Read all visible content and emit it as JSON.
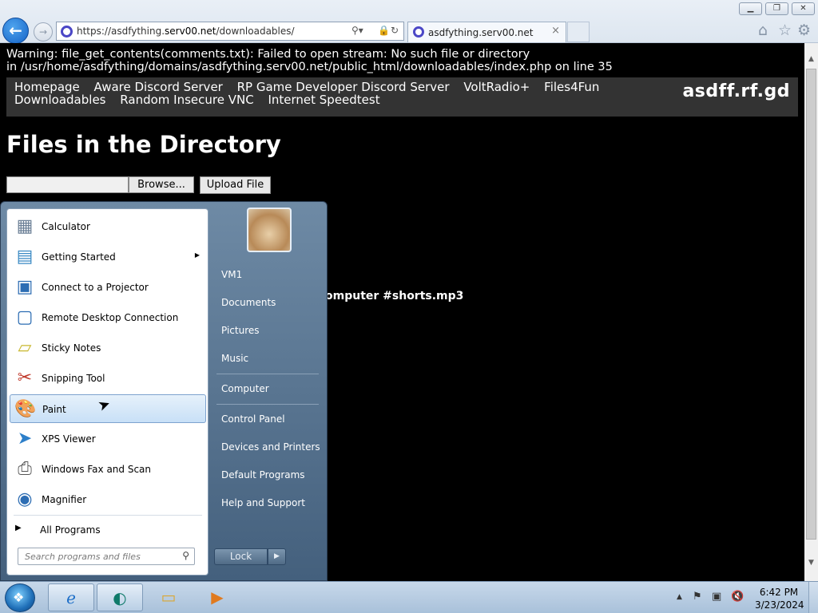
{
  "browser": {
    "url_prefix": "https://asdfything.",
    "url_domain": "serv00.net",
    "url_path": "/downloadables/",
    "tab_title": "asdfything.serv00.net",
    "tab_close": "×",
    "window_minimize": "▁",
    "window_restore": "❐",
    "window_close": "✕",
    "back_glyph": "←",
    "forward_glyph": "→"
  },
  "page": {
    "warning_line1": "Warning: file_get_contents(comments.txt): Failed to open stream: No such file or directory",
    "warning_line2": "in /usr/home/asdfything/domains/asdfything.serv00.net/public_html/downloadables/index.php on line 35",
    "nav_links": [
      "Homepage",
      "Aware Discord Server",
      "RP Game Developer Discord Server",
      "VoltRadio+",
      "Files4Fun",
      "Downloadables",
      "Random Insecure VNC",
      "Internet Speedtest"
    ],
    "brand": "asdff.rf.gd",
    "title": "Files in the Directory",
    "browse_label": "Browse...",
    "upload_label": "Upload File",
    "file_link_visible": "omputer #shorts.mp3"
  },
  "start_menu": {
    "programs": [
      {
        "label": "Calculator",
        "icon": "calculator-icon",
        "glyph": "▦"
      },
      {
        "label": "Getting Started",
        "icon": "getting-started-icon",
        "glyph": "▤"
      },
      {
        "label": "Connect to a Projector",
        "icon": "projector-icon",
        "glyph": "▣"
      },
      {
        "label": "Remote Desktop Connection",
        "icon": "remote-desktop-icon",
        "glyph": "▢"
      },
      {
        "label": "Sticky Notes",
        "icon": "sticky-notes-icon",
        "glyph": "▱"
      },
      {
        "label": "Snipping Tool",
        "icon": "scissors-icon",
        "glyph": "✂"
      },
      {
        "label": "Paint",
        "icon": "paint-palette-icon",
        "glyph": "🎨"
      },
      {
        "label": "XPS Viewer",
        "icon": "paper-plane-icon",
        "glyph": "➤"
      },
      {
        "label": "Windows Fax and Scan",
        "icon": "fax-icon",
        "glyph": "⎙"
      },
      {
        "label": "Magnifier",
        "icon": "magnifier-icon",
        "glyph": "◉"
      }
    ],
    "selected_program": "Paint",
    "all_programs": "All Programs",
    "search_placeholder": "Search programs and files",
    "right_items": [
      "VM1",
      "Documents",
      "Pictures",
      "Music",
      "Computer",
      "Control Panel",
      "Devices and Printers",
      "Default Programs",
      "Help and Support"
    ],
    "lock_label": "Lock"
  },
  "taskbar": {
    "time": "6:42 PM",
    "date": "3/23/2024"
  },
  "colors": {
    "page_bg": "#000000",
    "nav_bg": "#333333",
    "start_menu_bg": "#5a7590",
    "taskbar_bg": "#b9cfe5"
  }
}
